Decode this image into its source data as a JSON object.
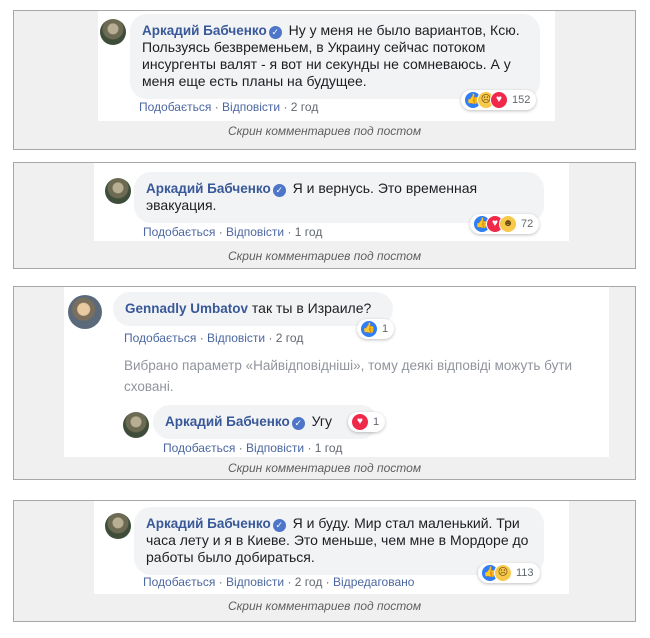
{
  "action_labels": {
    "like": "Подобається",
    "reply": "Відповісти",
    "edited": "Відредаговано"
  },
  "caption": "Скрин комментариев под постом",
  "screens": [
    {
      "comment": {
        "author": "Аркадий Бабченко",
        "text": "Ну у меня не было вариантов, Ксю. Пользуясь безвременьем, в Украину сейчас потоком инсургенты валят - я вот ни секунды не сомневаюсь. А у меня еще есть планы на будущее.",
        "time": "2 год",
        "reactions": [
          "like-icon",
          "sad-icon",
          "love-icon"
        ],
        "reaction_count": "152"
      }
    },
    {
      "comment": {
        "author": "Аркадий Бабченко",
        "text": "Я и вернусь. Это временная эвакуация.",
        "time": "1 год",
        "reactions": [
          "like-icon",
          "love-icon",
          "haha-icon"
        ],
        "reaction_count": "72"
      }
    },
    {
      "comment": {
        "author": "Gennadly Umbatov",
        "text": "так ты в Израиле?",
        "time": "2 год",
        "reactions": [
          "like-icon"
        ],
        "reaction_count": "1"
      },
      "filter_note": "Вибрано параметр «Найвідповідніші», тому деякі відповіді можуть бути сховані.",
      "reply": {
        "author": "Аркадий Бабченко",
        "text": "Угу",
        "time": "1 год",
        "reactions": [
          "love-icon"
        ],
        "reaction_count": "1"
      }
    },
    {
      "comment": {
        "author": "Аркадий Бабченко",
        "text": "Я и буду. Мир стал маленький. Три часа лету и я в Киеве. Это меньше, чем мне в Мордоре до работы было добираться.",
        "time": "2 год",
        "reactions": [
          "like-icon",
          "sad-icon"
        ],
        "reaction_count": "113"
      }
    }
  ]
}
